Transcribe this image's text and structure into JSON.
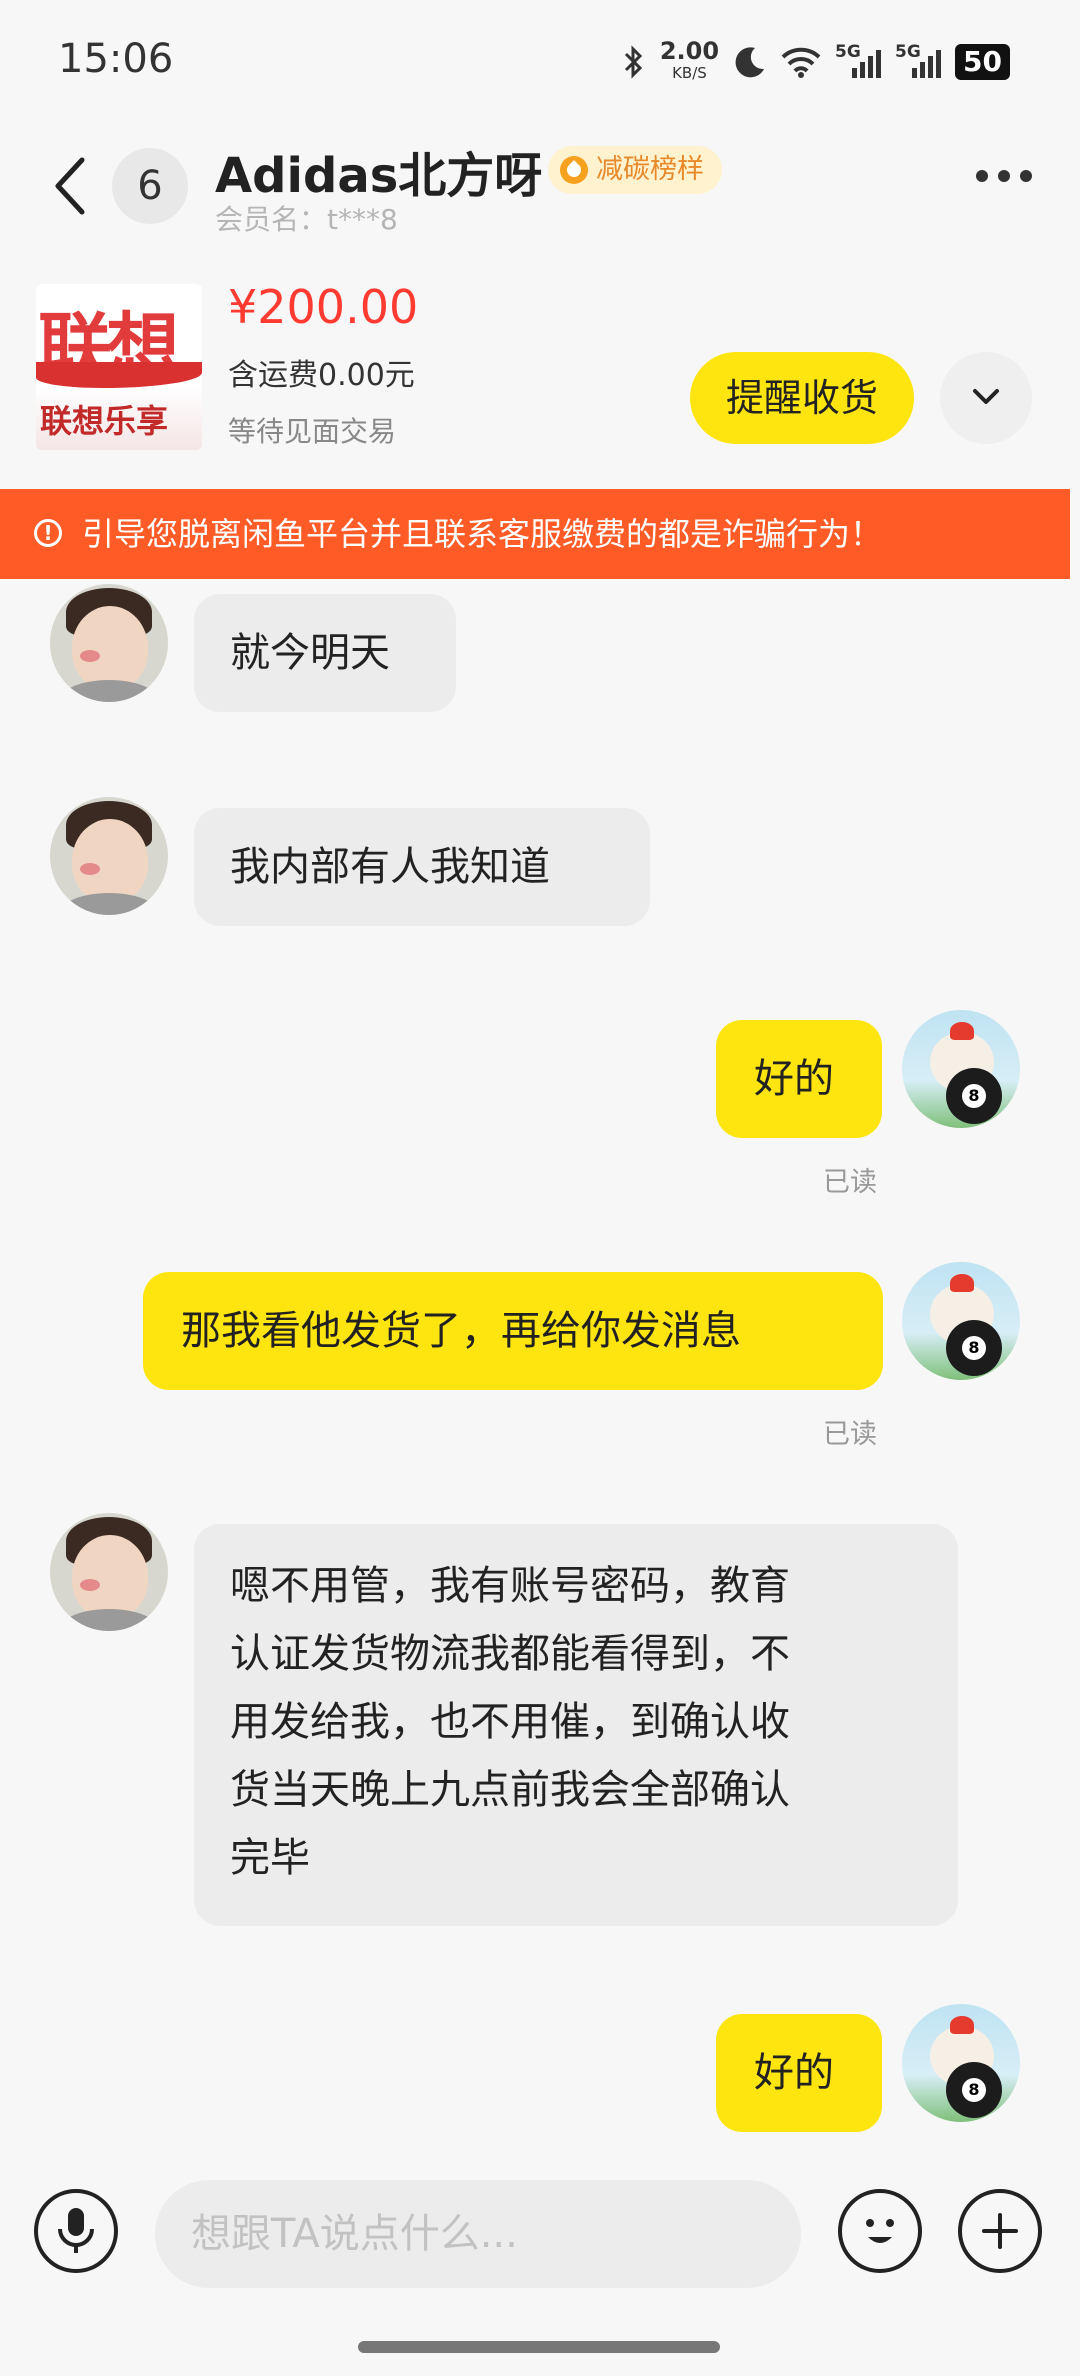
{
  "status_bar": {
    "time": "15:06",
    "net_speed_value": "2.00",
    "net_speed_unit": "KB/S",
    "signal1_label": "5G",
    "signal2_label": "5G",
    "battery": "50",
    "icons": [
      "bluetooth-icon",
      "moon-icon",
      "wifi-icon",
      "signal-icon",
      "battery-icon"
    ]
  },
  "header": {
    "unread_count": "6",
    "title": "Adidas北方呀",
    "badge": "减碳榜样",
    "member": "会员名：t***8"
  },
  "product": {
    "image_text_top": "联想",
    "image_text_bottom": "联想乐享",
    "price": "¥200.00",
    "shipping": "含运费0.00元",
    "status": "等待见面交易",
    "remind_button": "提醒收货"
  },
  "warning": {
    "text": "引导您脱离闲鱼平台并且联系客服缴费的都是诈骗行为！"
  },
  "messages": [
    {
      "side": "left",
      "text": "就今明天"
    },
    {
      "side": "left",
      "text": "我内部有人我知道"
    },
    {
      "side": "right",
      "text": "好的",
      "read": "已读"
    },
    {
      "side": "right",
      "text": "那我看他发货了，再给你发消息",
      "read": "已读"
    },
    {
      "side": "left",
      "lines": [
        "嗯不用管，我有账号密码，教育",
        "认证发货物流我都能看得到，不",
        "用发给我，也不用催，到确认收",
        "货当天晚上九点前我会全部确认",
        "完毕"
      ]
    },
    {
      "side": "right",
      "text": "好的"
    }
  ],
  "input": {
    "placeholder": "想跟TA说点什么..."
  },
  "colors": {
    "accent_yellow": "#ffe50f",
    "warning_orange": "#ff5b26",
    "price_red": "#ff3a30"
  }
}
